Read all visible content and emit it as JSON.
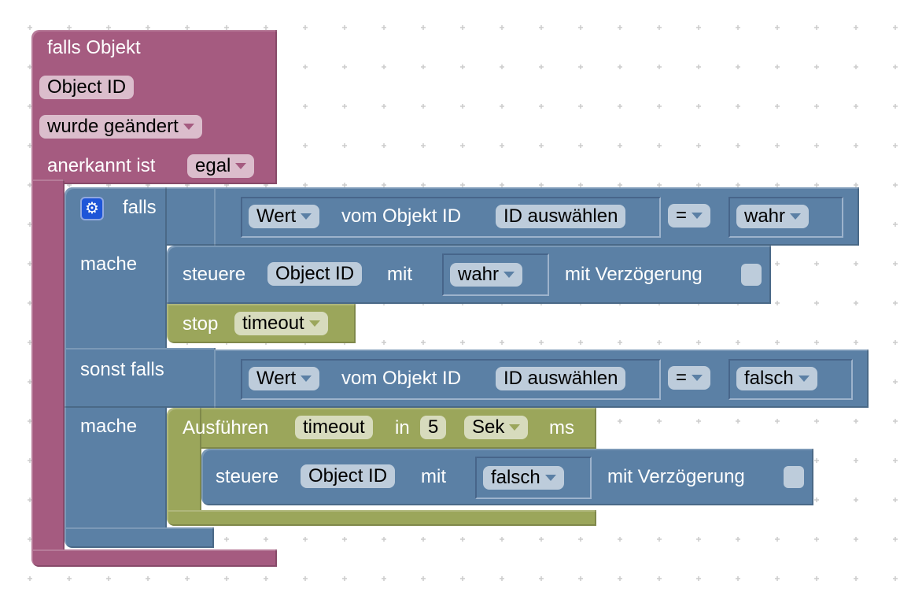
{
  "trigger": {
    "title": "falls Objekt",
    "object_field": "Object ID",
    "condition_dropdown": "wurde geändert",
    "ack_label": "anerkannt ist",
    "ack_dropdown": "egal"
  },
  "if_block": {
    "if_label": "falls",
    "do_label_1": "mache",
    "elseif_label": "sonst falls",
    "do_label_2": "mache",
    "condition1": {
      "attr_dropdown": "Wert",
      "of_object_label": "vom Objekt ID",
      "id_field": "ID auswählen",
      "operator": "=",
      "value_dropdown": "wahr"
    },
    "condition2": {
      "attr_dropdown": "Wert",
      "of_object_label": "vom Objekt ID",
      "id_field": "ID auswählen",
      "operator": "=",
      "value_dropdown": "falsch"
    }
  },
  "control1": {
    "label": "steuere",
    "object_field": "Object ID",
    "with_label": "mit",
    "value_dropdown": "wahr",
    "delay_label": "mit Verzögerung",
    "delay_checked": false
  },
  "stop": {
    "label": "stop",
    "timer_dropdown": "timeout"
  },
  "run_after": {
    "label": "Ausführen",
    "timer_field": "timeout",
    "in_label": "in",
    "amount": "5",
    "unit_dropdown": "Sek",
    "ms_label": "ms"
  },
  "control2": {
    "label": "steuere",
    "object_field": "Object ID",
    "with_label": "mit",
    "value_dropdown": "falsch",
    "delay_label": "mit Verzögerung",
    "delay_checked": false
  },
  "colors": {
    "trigger": "#a55b80",
    "logic": "#5b80a5",
    "timer": "#9ba65b"
  }
}
